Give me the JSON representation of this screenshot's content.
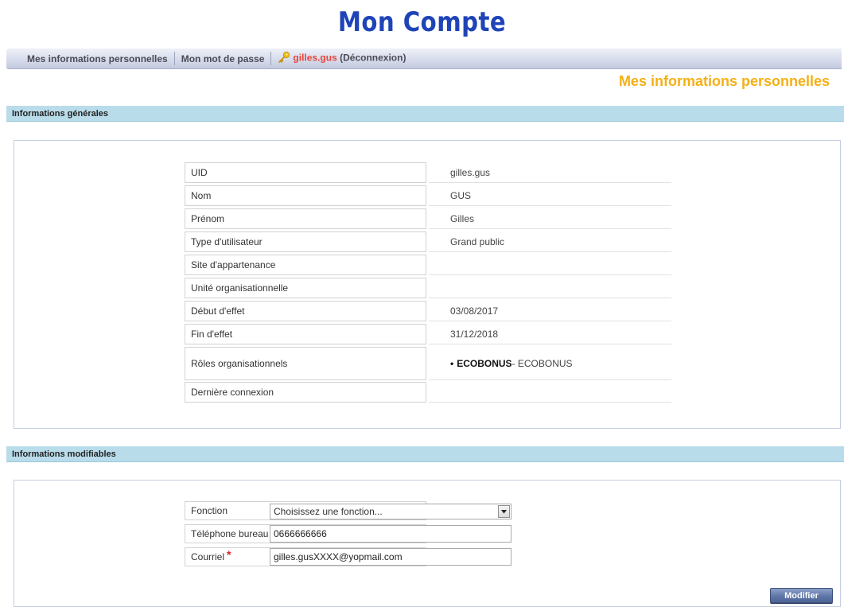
{
  "page_title": "Mon Compte",
  "nav": {
    "items": [
      "Mes informations personnelles",
      "Mon mot de passe"
    ],
    "user": "gilles.gus",
    "logout": "(Déconnexion)"
  },
  "section_heading": "Mes informations personnelles",
  "general": {
    "heading": "Informations générales",
    "rows": [
      {
        "label": "UID",
        "value": "gilles.gus"
      },
      {
        "label": "Nom",
        "value": "GUS"
      },
      {
        "label": "Prénom",
        "value": "Gilles"
      },
      {
        "label": "Type d'utilisateur",
        "value": "Grand public"
      },
      {
        "label": "Site d'appartenance",
        "value": ""
      },
      {
        "label": "Unité organisationnelle",
        "value": ""
      },
      {
        "label": "Début d'effet",
        "value": "03/08/2017"
      },
      {
        "label": "Fin d'effet",
        "value": "31/12/2018"
      },
      {
        "label": "Rôles organisationnels",
        "role_bullet": "•",
        "role_code": "ECOBONUS",
        "role_desc": " - ECOBONUS"
      },
      {
        "label": "Dernière connexion",
        "value": ""
      }
    ]
  },
  "editable": {
    "heading": "Informations modifiables",
    "fonction_label": "Fonction",
    "fonction_selected": "Choisissez une fonction...",
    "phone_label": "Téléphone bureau",
    "phone_value": "0666666666",
    "email_label": "Courriel",
    "email_required": "*",
    "email_value": "gilles.gusXXXX@yopmail.com"
  },
  "modify_button": "Modifier",
  "colors": {
    "title": "#1f44b7",
    "heading_accent": "#f4b016",
    "band": "#b9dcea",
    "user_link": "#e8453c",
    "button": "#5f76a8"
  }
}
